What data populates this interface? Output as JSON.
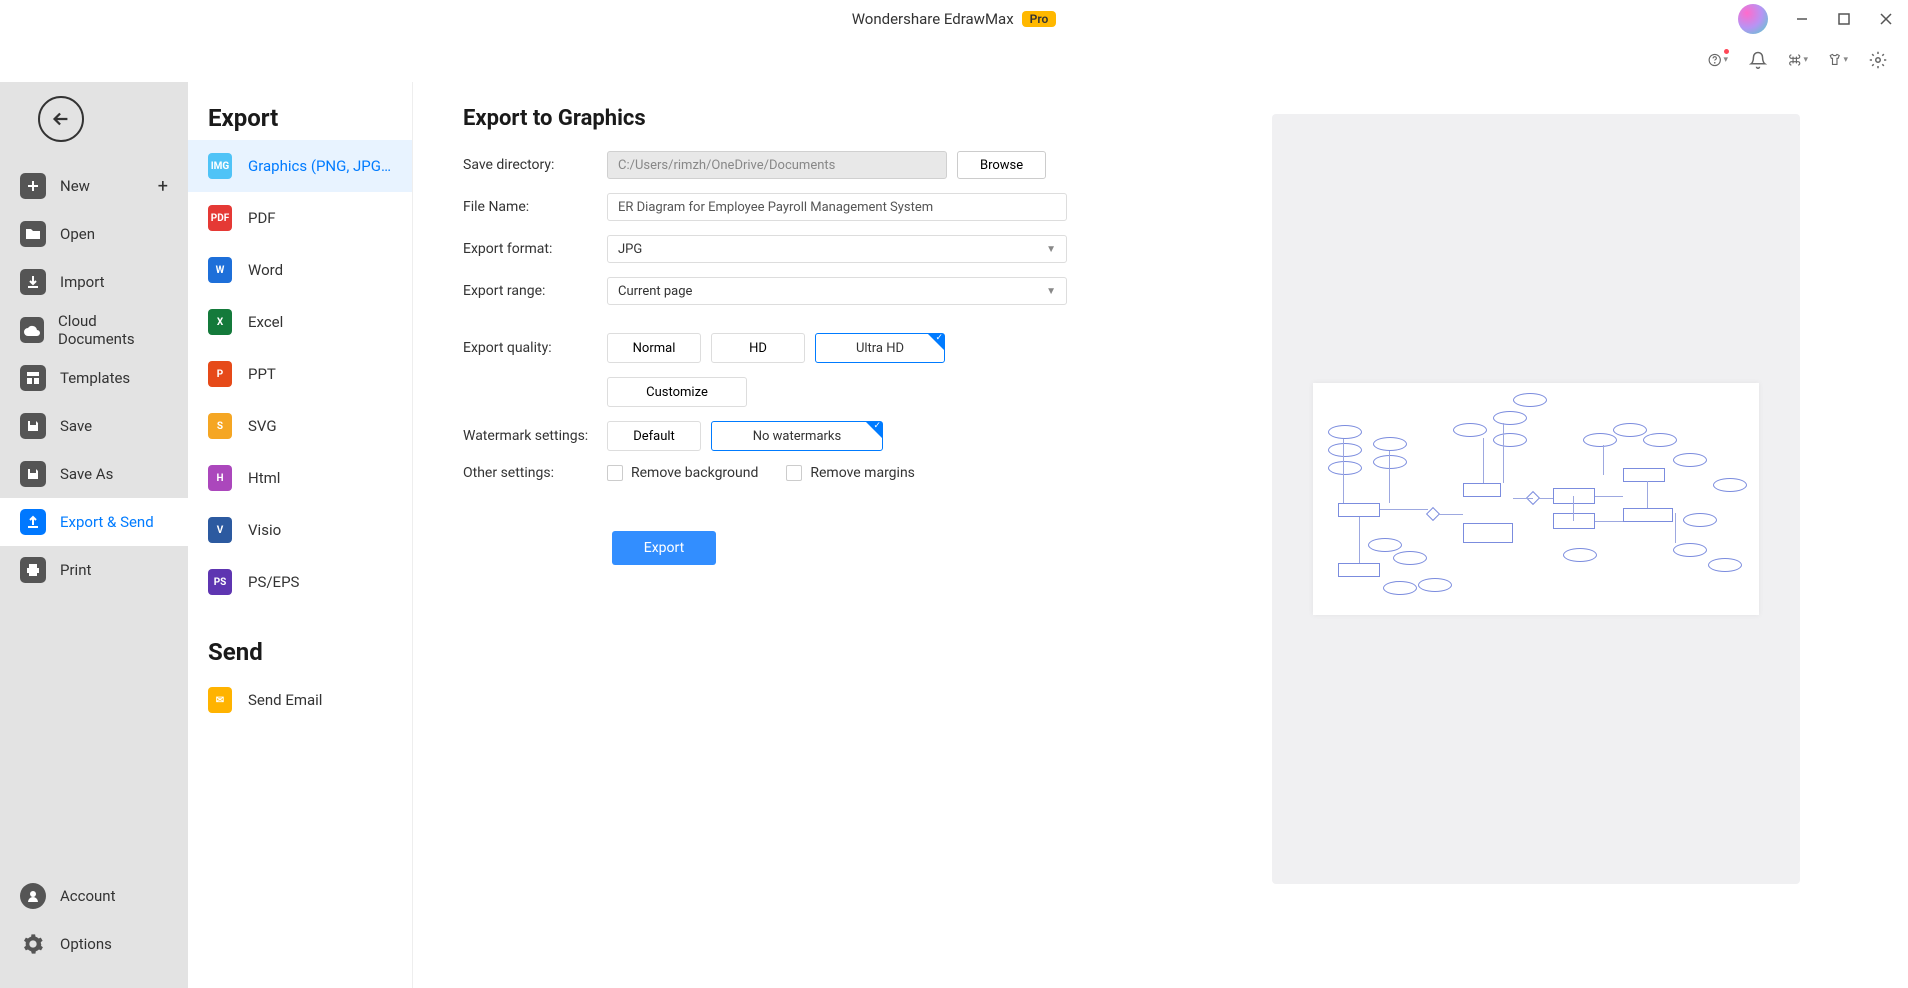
{
  "app": {
    "title": "Wondershare EdrawMax",
    "badge": "Pro"
  },
  "leftnav": {
    "new": "New",
    "open": "Open",
    "import": "Import",
    "cloud": "Cloud Documents",
    "templates": "Templates",
    "save": "Save",
    "saveas": "Save As",
    "exportsend": "Export & Send",
    "print": "Print",
    "account": "Account",
    "options": "Options"
  },
  "exportPanel": {
    "heading": "Export",
    "items": {
      "graphics": "Graphics (PNG, JPG et...",
      "pdf": "PDF",
      "word": "Word",
      "excel": "Excel",
      "ppt": "PPT",
      "svg": "SVG",
      "html": "Html",
      "visio": "Visio",
      "pseps": "PS/EPS"
    },
    "sendHeading": "Send",
    "sendEmail": "Send Email"
  },
  "form": {
    "title": "Export to Graphics",
    "saveDirLabel": "Save directory:",
    "saveDirValue": "C:/Users/rimzh/OneDrive/Documents",
    "browse": "Browse",
    "fileNameLabel": "File Name:",
    "fileNameValue": "ER Diagram for Employee Payroll Management System",
    "formatLabel": "Export format:",
    "formatValue": "JPG",
    "rangeLabel": "Export range:",
    "rangeValue": "Current page",
    "qualityLabel": "Export quality:",
    "quality": {
      "normal": "Normal",
      "hd": "HD",
      "ultra": "Ultra HD",
      "customize": "Customize"
    },
    "watermarkLabel": "Watermark settings:",
    "watermark": {
      "default": "Default",
      "none": "No watermarks"
    },
    "otherLabel": "Other settings:",
    "removeBg": "Remove background",
    "removeMargins": "Remove margins",
    "exportBtn": "Export"
  },
  "iconColors": {
    "graphics": "#4fc3f7",
    "pdf": "#e53935",
    "word": "#1e6fd9",
    "excel": "#147a3b",
    "ppt": "#e64a19",
    "svg": "#f5a623",
    "html": "#ab47bc",
    "visio": "#2c5aa0",
    "pseps": "#5e35b1",
    "email": "#ffb300"
  }
}
